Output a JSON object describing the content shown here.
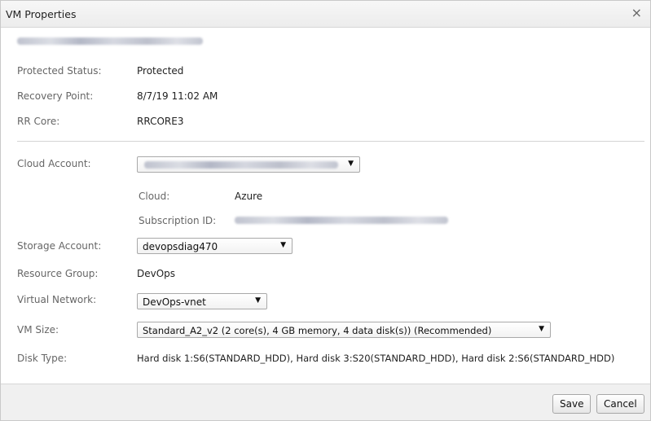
{
  "dialog": {
    "title": "VM Properties",
    "close_symbol": "×"
  },
  "info": {
    "protected_status": {
      "label": "Protected Status:",
      "value": "Protected"
    },
    "recovery_point": {
      "label": "Recovery Point:",
      "value": "8/7/19 11:02 AM"
    },
    "rr_core": {
      "label": "RR Core:",
      "value": "RRCORE3"
    }
  },
  "form": {
    "cloud_account": {
      "label": "Cloud Account:"
    },
    "cloud": {
      "label": "Cloud:",
      "value": "Azure"
    },
    "subscription": {
      "label": "Subscription ID:"
    },
    "storage_account": {
      "label": "Storage Account:",
      "selected": "devopsdiag470"
    },
    "resource_group": {
      "label": "Resource Group:",
      "value": "DevOps"
    },
    "virtual_network": {
      "label": "Virtual Network:",
      "selected": "DevOps-vnet"
    },
    "vm_size": {
      "label": "VM Size:",
      "selected": "Standard_A2_v2 (2 core(s), 4 GB memory, 4 data disk(s)) (Recommended)"
    },
    "disk_type": {
      "label": "Disk Type:",
      "value": "Hard disk 1:S6(STANDARD_HDD), Hard disk 3:S20(STANDARD_HDD), Hard disk 2:S6(STANDARD_HDD)"
    }
  },
  "footer": {
    "save_label": "Save",
    "cancel_label": "Cancel"
  },
  "icons": {
    "dropdown_arrow": "▼"
  }
}
